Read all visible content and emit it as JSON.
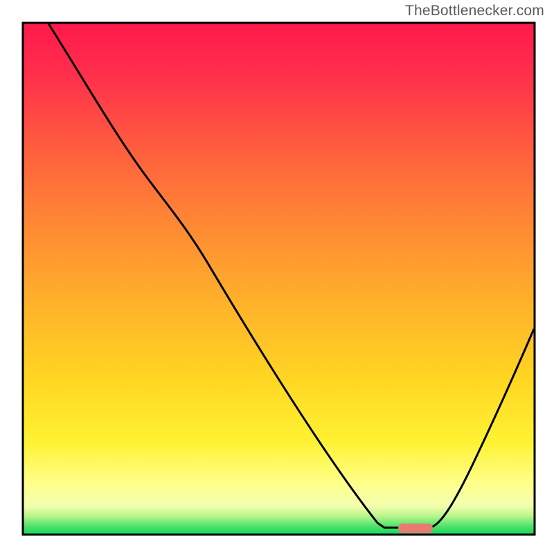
{
  "attribution": "TheBottlenecker.com",
  "chart_data": {
    "type": "line",
    "title": "",
    "xlabel": "",
    "ylabel": "",
    "xlim": [
      0,
      100
    ],
    "ylim": [
      0,
      100
    ],
    "grid": false,
    "legend": false,
    "background_gradient": {
      "direction": "vertical",
      "stops": [
        {
          "pos": 0.0,
          "color": "#ff1a4b"
        },
        {
          "pos": 0.25,
          "color": "#ff5f3e"
        },
        {
          "pos": 0.55,
          "color": "#ffb22a"
        },
        {
          "pos": 0.82,
          "color": "#fff233"
        },
        {
          "pos": 0.95,
          "color": "#c8f894"
        },
        {
          "pos": 1.0,
          "color": "#17d85e"
        }
      ]
    },
    "series": [
      {
        "name": "curve",
        "color": "#000000",
        "x": [
          5,
          12,
          20,
          25,
          30,
          36,
          45,
          55,
          63,
          70,
          74,
          78,
          80,
          84,
          90,
          95,
          100
        ],
        "y": [
          100,
          87,
          75,
          69,
          63,
          55,
          40,
          24,
          12,
          2,
          0,
          0,
          0,
          2,
          15,
          27,
          36
        ]
      }
    ],
    "marker": {
      "name": "highlight-segment",
      "color": "#e77b73",
      "x_range": [
        73.5,
        80.0
      ],
      "y": 0
    }
  }
}
